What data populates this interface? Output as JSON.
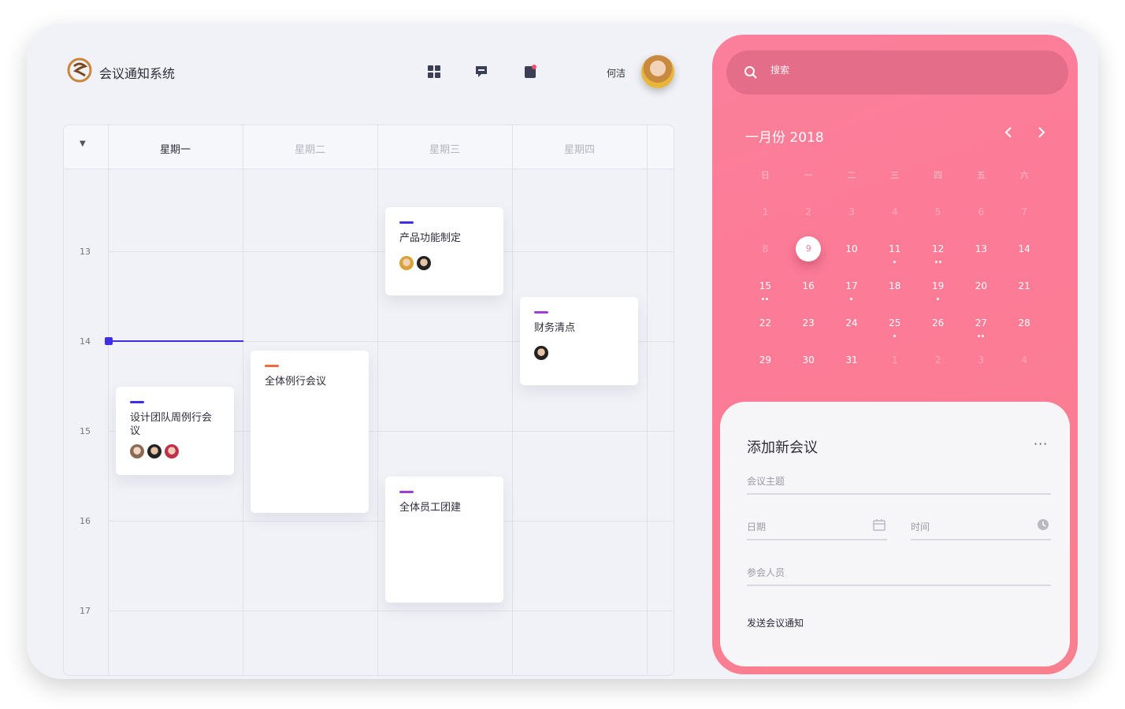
{
  "app": {
    "title": "会议通知系统",
    "user_name": "何洁"
  },
  "header": {
    "icons": [
      "grid-icon",
      "chat-icon",
      "notification-icon"
    ]
  },
  "schedule": {
    "days": [
      "星期一",
      "星期二",
      "星期三",
      "星期四"
    ],
    "hours": [
      "13",
      "14",
      "15",
      "16",
      "17"
    ],
    "events": [
      {
        "title": "产品功能制定",
        "accent": "#3b2fe8"
      },
      {
        "title": "财务清点",
        "accent": "#9b3fd8"
      },
      {
        "title": "全体例行会议",
        "accent": "#f26a3c"
      },
      {
        "title": "设计团队周例行会议",
        "accent": "#3b2fe8"
      },
      {
        "title": "全体员工团建",
        "accent": "#9b3fd8"
      }
    ]
  },
  "calendar": {
    "month_label": "一月份",
    "year": "2018",
    "weekdays": [
      "日",
      "一",
      "二",
      "三",
      "四",
      "五",
      "六"
    ],
    "weeks": [
      [
        "1",
        "2",
        "3",
        "4",
        "5",
        "6",
        "7"
      ],
      [
        "8",
        "9",
        "10",
        "11",
        "12",
        "13",
        "14"
      ],
      [
        "15",
        "16",
        "17",
        "18",
        "19",
        "20",
        "21"
      ],
      [
        "22",
        "23",
        "24",
        "25",
        "26",
        "27",
        "28"
      ],
      [
        "29",
        "30",
        "31",
        "1",
        "2",
        "3",
        "4"
      ]
    ],
    "selected": "9"
  },
  "search": {
    "placeholder": "搜索"
  },
  "form": {
    "title": "添加新会议",
    "more_label": "···",
    "topic_placeholder": "会议主题",
    "date_placeholder": "日期",
    "time_placeholder": "时间",
    "attendees_placeholder": "参会人员",
    "send_label": "发送会议通知"
  },
  "colors": {
    "accent": "#fb7f9a",
    "primary": "#3b2fe8"
  }
}
